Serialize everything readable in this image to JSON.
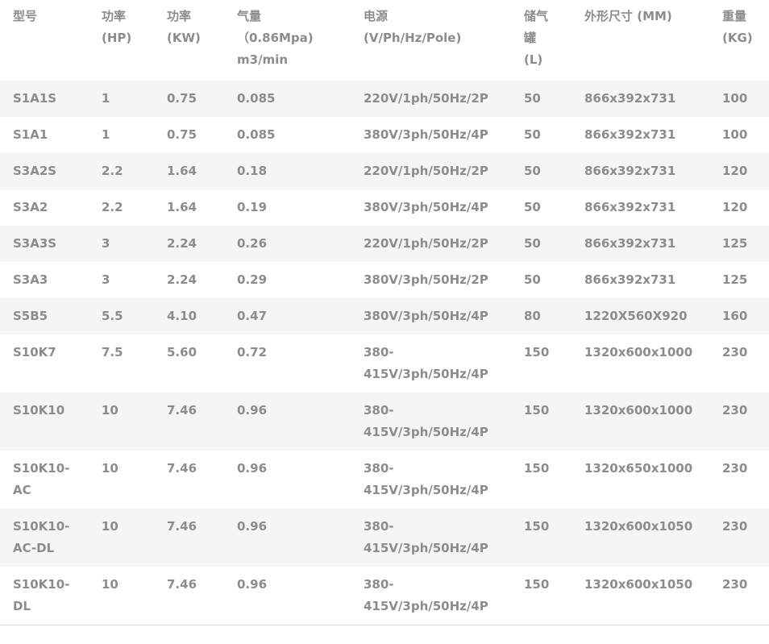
{
  "table": {
    "headers": [
      "型号",
      "功率\n(HP)",
      "功率\n(KW)",
      "气量\n（0.86Mpa)\nm3/min",
      "电源\n(V/Ph/Hz/Pole)",
      "储气\n罐\n(L)",
      "外形尺寸 (MM)",
      "重量\n(KG)"
    ],
    "rows": [
      [
        "S1A1S",
        "1",
        "0.75",
        "0.085",
        "220V/1ph/50Hz/2P",
        "50",
        "866x392x731",
        "100"
      ],
      [
        "S1A1",
        "1",
        "0.75",
        "0.085",
        "380V/3ph/50Hz/4P",
        "50",
        "866x392x731",
        "100"
      ],
      [
        "S3A2S",
        "2.2",
        "1.64",
        "0.18",
        "220V/1ph/50Hz/2P",
        "50",
        "866x392x731",
        "120"
      ],
      [
        "S3A2",
        "2.2",
        "1.64",
        "0.19",
        "380V/3ph/50Hz/4P",
        "50",
        "866x392x731",
        "120"
      ],
      [
        "S3A3S",
        "3",
        "2.24",
        "0.26",
        "220V/1ph/50Hz/2P",
        "50",
        "866x392x731",
        "125"
      ],
      [
        "S3A3",
        "3",
        "2.24",
        "0.29",
        "380V/3ph/50Hz/2P",
        "50",
        "866x392x731",
        "125"
      ],
      [
        "S5B5",
        "5.5",
        "4.10",
        "0.47",
        "380V/3ph/50Hz/4P",
        "80",
        "1220X560X920",
        "160"
      ],
      [
        "S10K7",
        "7.5",
        "5.60",
        "0.72",
        "380-\n415V/3ph/50Hz/4P",
        "150",
        "1320x600x1000",
        "230"
      ],
      [
        "S10K10",
        "10",
        "7.46",
        "0.96",
        "380-\n415V/3ph/50Hz/4P",
        "150",
        "1320x600x1000",
        "230"
      ],
      [
        "S10K10-\nAC",
        "10",
        "7.46",
        "0.96",
        "380-\n415V/3ph/50Hz/4P",
        "150",
        "1320x650x1000",
        "230"
      ],
      [
        "S10K10-\nAC-DL",
        "10",
        "7.46",
        "0.96",
        "380-\n415V/3ph/50Hz/4P",
        "150",
        "1320x600x1050",
        "230"
      ],
      [
        "S10K10-\nDL",
        "10",
        "7.46",
        "0.96",
        "380-\n415V/3ph/50Hz/4P",
        "150",
        "1320x600x1050",
        "230"
      ]
    ]
  }
}
